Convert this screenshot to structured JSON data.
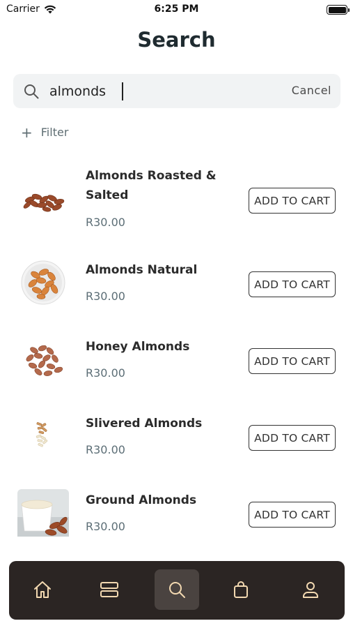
{
  "status_bar": {
    "carrier": "Carrier",
    "time": "6:25 PM",
    "battery_level": 1.0
  },
  "page_title": "Search",
  "search": {
    "value": "almonds",
    "placeholder": "",
    "cancel_label": "Cancel"
  },
  "filter": {
    "label": "Filter"
  },
  "products": [
    {
      "name": "Almonds Roasted & Salted",
      "price": "R30.00",
      "button_label": "ADD TO CART"
    },
    {
      "name": "Almonds Natural",
      "price": "R30.00",
      "button_label": "ADD TO CART"
    },
    {
      "name": "Honey Almonds",
      "price": "R30.00",
      "button_label": "ADD TO CART"
    },
    {
      "name": "Slivered Almonds",
      "price": "R30.00",
      "button_label": "ADD TO CART"
    },
    {
      "name": "Ground Almonds",
      "price": "R30.00",
      "button_label": "ADD TO CART"
    }
  ],
  "bottom_nav": {
    "items": [
      {
        "icon": "home-icon",
        "active": false
      },
      {
        "icon": "categories-icon",
        "active": false
      },
      {
        "icon": "search-icon",
        "active": true
      },
      {
        "icon": "shopping-bag-icon",
        "active": false
      },
      {
        "icon": "profile-icon",
        "active": false
      }
    ],
    "icon_color": "#f3d9b1",
    "background": "#2b2523"
  },
  "colors": {
    "title": "#1f2b30",
    "price": "#5c6e76",
    "search_bg": "#f1f3f4"
  }
}
